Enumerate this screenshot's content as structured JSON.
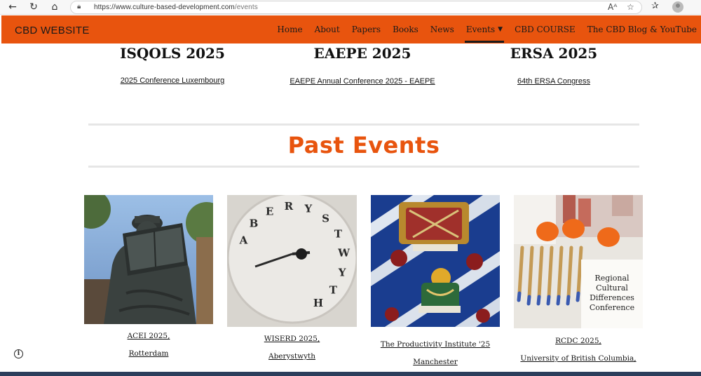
{
  "browser": {
    "url_host": "https://www.culture-based-development.com",
    "url_path": "/events",
    "icons": [
      "back-icon",
      "refresh-icon",
      "home-icon",
      "lock-icon",
      "read-aloud-icon",
      "favorite-icon",
      "collections-icon",
      "profile-icon"
    ]
  },
  "site": {
    "logo": "CBD WEBSITE",
    "accent_color": "#e8540e",
    "nav": [
      {
        "label": "Home"
      },
      {
        "label": "About"
      },
      {
        "label": "Papers"
      },
      {
        "label": "Books"
      },
      {
        "label": "News"
      },
      {
        "label": "Events",
        "active": true
      },
      {
        "label": "CBD COURSE"
      },
      {
        "label": "The CBD Blog & YouTube"
      }
    ]
  },
  "upcoming": [
    {
      "title": "ISQOLS 2025",
      "link": "2025 Conference Luxembourg"
    },
    {
      "title": "EAEPE 2025",
      "link": "EAEPE Annual Conference 2025 - EAEPE"
    },
    {
      "title": "ERSA 2025",
      "link": "64th ERSA Congress"
    }
  ],
  "past_title": "Past Events",
  "past": [
    {
      "line1": "ACEI 2025,",
      "line2": "Rotterdam",
      "image": "erasmus-statue-photo"
    },
    {
      "line1": "WISERD 2025,",
      "line2": "Aberystwyth",
      "image": "aberystwyth-clock-photo"
    },
    {
      "line1": "The Productivity Institute '25",
      "line2": "Manchester",
      "image": "stained-glass-photo"
    },
    {
      "line1": "RCDC 2025,",
      "line2": "University of British Columbia,",
      "image": "conference-desk-photo"
    }
  ],
  "clock_letters": "ABERYSTWYTH"
}
